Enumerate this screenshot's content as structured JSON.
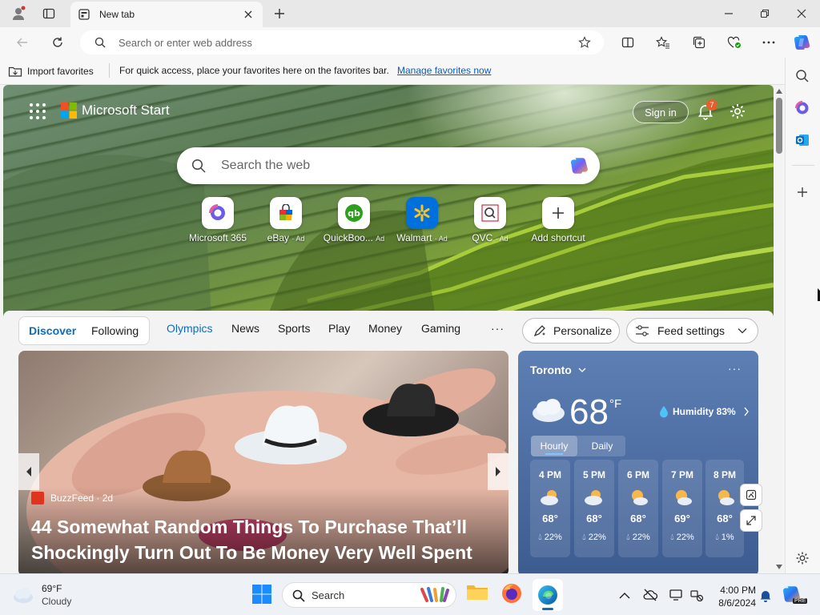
{
  "browser": {
    "tab_title": "New tab",
    "address_placeholder": "Search or enter web address"
  },
  "favorites_bar": {
    "import_label": "Import favorites",
    "message": "For quick access, place your favorites here on the favorites bar.",
    "manage_link": "Manage favorites now"
  },
  "start": {
    "brand": "Microsoft Start",
    "sign_in": "Sign in",
    "notification_count": "7",
    "search_placeholder": "Search the web",
    "shortcuts": [
      {
        "label": "Microsoft 365",
        "ad": ""
      },
      {
        "label": "eBay",
        "ad": "· Ad"
      },
      {
        "label": "QuickBoo...",
        "ad": "Ad"
      },
      {
        "label": "Walmart",
        "ad": "· Ad"
      },
      {
        "label": "QVC",
        "ad": "· Ad"
      },
      {
        "label": "Add shortcut",
        "ad": ""
      }
    ]
  },
  "feed_nav": {
    "discover": "Discover",
    "following": "Following",
    "tabs": [
      "Olympics",
      "News",
      "Sports",
      "Play",
      "Money",
      "Gaming"
    ],
    "more": "···",
    "personalize": "Personalize",
    "feed_settings": "Feed settings"
  },
  "article": {
    "source": "BuzzFeed · 2d",
    "headline_line1": "44 Somewhat Random Things To Purchase That’ll",
    "headline_line2": "Shockingly Turn Out To Be Money Very Well Spent"
  },
  "weather": {
    "city": "Toronto",
    "temp": "68",
    "unit": "°F",
    "humidity": "Humidity 83%",
    "tabs": [
      "Hourly",
      "Daily"
    ],
    "hours": [
      {
        "time": "4 PM",
        "temp": "68°",
        "precip": "22%"
      },
      {
        "time": "5 PM",
        "temp": "68°",
        "precip": "22%"
      },
      {
        "time": "6 PM",
        "temp": "68°",
        "precip": "22%"
      },
      {
        "time": "7 PM",
        "temp": "69°",
        "precip": "22%"
      },
      {
        "time": "8 PM",
        "temp": "68°",
        "precip": "1%"
      }
    ]
  },
  "taskbar": {
    "weather_temp": "69°F",
    "weather_desc": "Cloudy",
    "search_label": "Search",
    "time": "4:00 PM",
    "date": "8/6/2024"
  },
  "colors": {
    "accent": "#0f6cbd",
    "weather_bg": "#4a6aa0",
    "hero_green": "#6f9243"
  }
}
